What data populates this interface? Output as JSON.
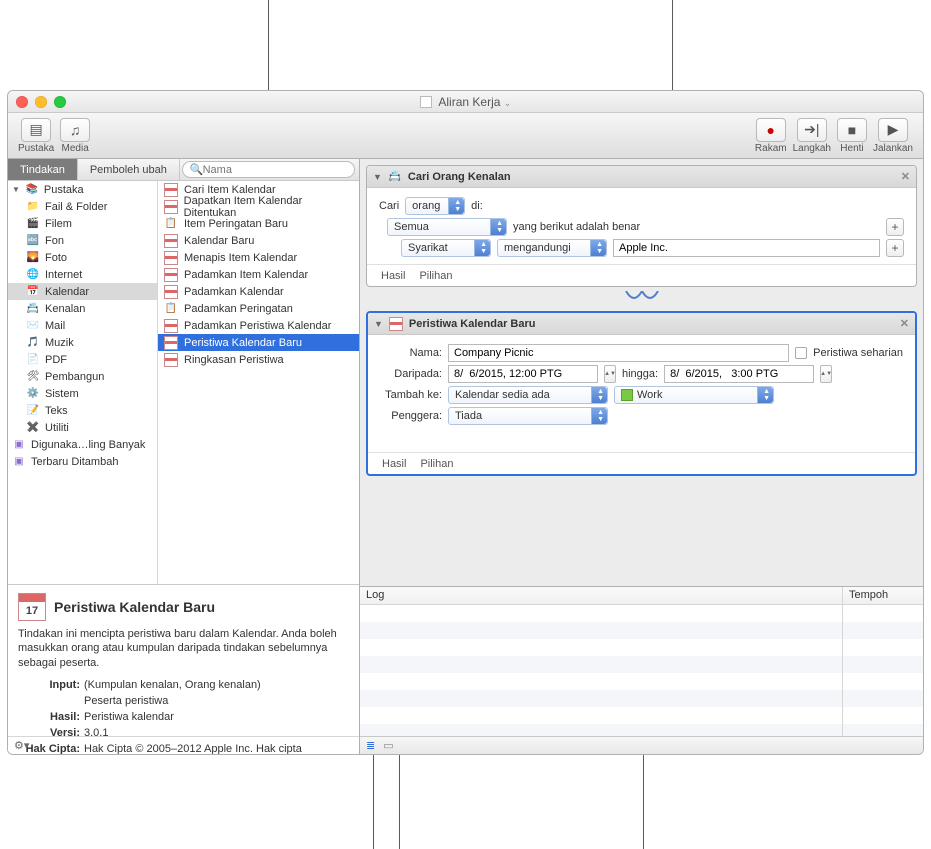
{
  "window": {
    "title": "Aliran Kerja"
  },
  "toolbar": {
    "pustaka": "Pustaka",
    "media": "Media",
    "rakam": "Rakam",
    "langkah": "Langkah",
    "henti": "Henti",
    "jalankan": "Jalankan"
  },
  "tabs": {
    "tindakan": "Tindakan",
    "pembolehubah": "Pemboleh ubah"
  },
  "search": {
    "placeholder": "Nama"
  },
  "library_root": "Pustaka",
  "categories": [
    {
      "label": "Fail & Folder"
    },
    {
      "label": "Filem"
    },
    {
      "label": "Fon"
    },
    {
      "label": "Foto"
    },
    {
      "label": "Internet"
    },
    {
      "label": "Kalendar",
      "selected": true
    },
    {
      "label": "Kenalan"
    },
    {
      "label": "Mail"
    },
    {
      "label": "Muzik"
    },
    {
      "label": "PDF"
    },
    {
      "label": "Pembangun"
    },
    {
      "label": "Sistem"
    },
    {
      "label": "Teks"
    },
    {
      "label": "Utiliti"
    },
    {
      "label": "Digunaka…ling Banyak"
    },
    {
      "label": "Terbaru Ditambah"
    }
  ],
  "actions": [
    {
      "label": "Cari Item Kalendar"
    },
    {
      "label": "Dapatkan Item Kalendar Ditentukan"
    },
    {
      "label": "Item Peringatan Baru"
    },
    {
      "label": "Kalendar Baru"
    },
    {
      "label": "Menapis Item Kalendar"
    },
    {
      "label": "Padamkan Item Kalendar"
    },
    {
      "label": "Padamkan Kalendar"
    },
    {
      "label": "Padamkan Peringatan"
    },
    {
      "label": "Padamkan Peristiwa Kalendar"
    },
    {
      "label": "Peristiwa Kalendar Baru",
      "selected": true
    },
    {
      "label": "Ringkasan Peristiwa"
    }
  ],
  "detail": {
    "title": "Peristiwa Kalendar Baru",
    "desc": "Tindakan ini mencipta peristiwa baru dalam Kalendar. Anda boleh masukkan orang atau kumpulan daripada tindakan sebelumnya sebagai peserta.",
    "input_label": "Input:",
    "input_val1": "(Kumpulan kenalan, Orang kenalan)",
    "input_val2": "Peserta peristiwa",
    "hasil_label": "Hasil:",
    "hasil_val": "Peristiwa kalendar",
    "versi_label": "Versi:",
    "versi_val": "3.0.1",
    "hak_label": "Hak Cipta:",
    "hak_val": "Hak Cipta © 2005–2012 Apple Inc.  Hak cipta",
    "cal_num": "17"
  },
  "card1": {
    "title": "Cari Orang Kenalan",
    "cari_label": "Cari",
    "cari_val": "orang",
    "di": "di:",
    "scope": "Semua",
    "scope_caption": "yang berikut adalah benar",
    "field": "Syarikat",
    "op": "mengandungi",
    "value": "Apple Inc.",
    "hasil": "Hasil",
    "pilihan": "Pilihan"
  },
  "card2": {
    "title": "Peristiwa Kalendar Baru",
    "nama_label": "Nama:",
    "nama_val": "Company Picnic",
    "allday": "Peristiwa seharian",
    "daripada_label": "Daripada:",
    "from_val": "8/  6/2015, 12:00 PTG",
    "hingga": "hingga:",
    "to_val": "8/  6/2015,   3:00 PTG",
    "tambah_label": "Tambah ke:",
    "tambah_val": "Kalendar sedia ada",
    "work": "Work",
    "penggera_label": "Penggera:",
    "penggera_val": "Tiada",
    "hasil": "Hasil",
    "pilihan": "Pilihan"
  },
  "log": {
    "log": "Log",
    "tempoh": "Tempoh"
  }
}
